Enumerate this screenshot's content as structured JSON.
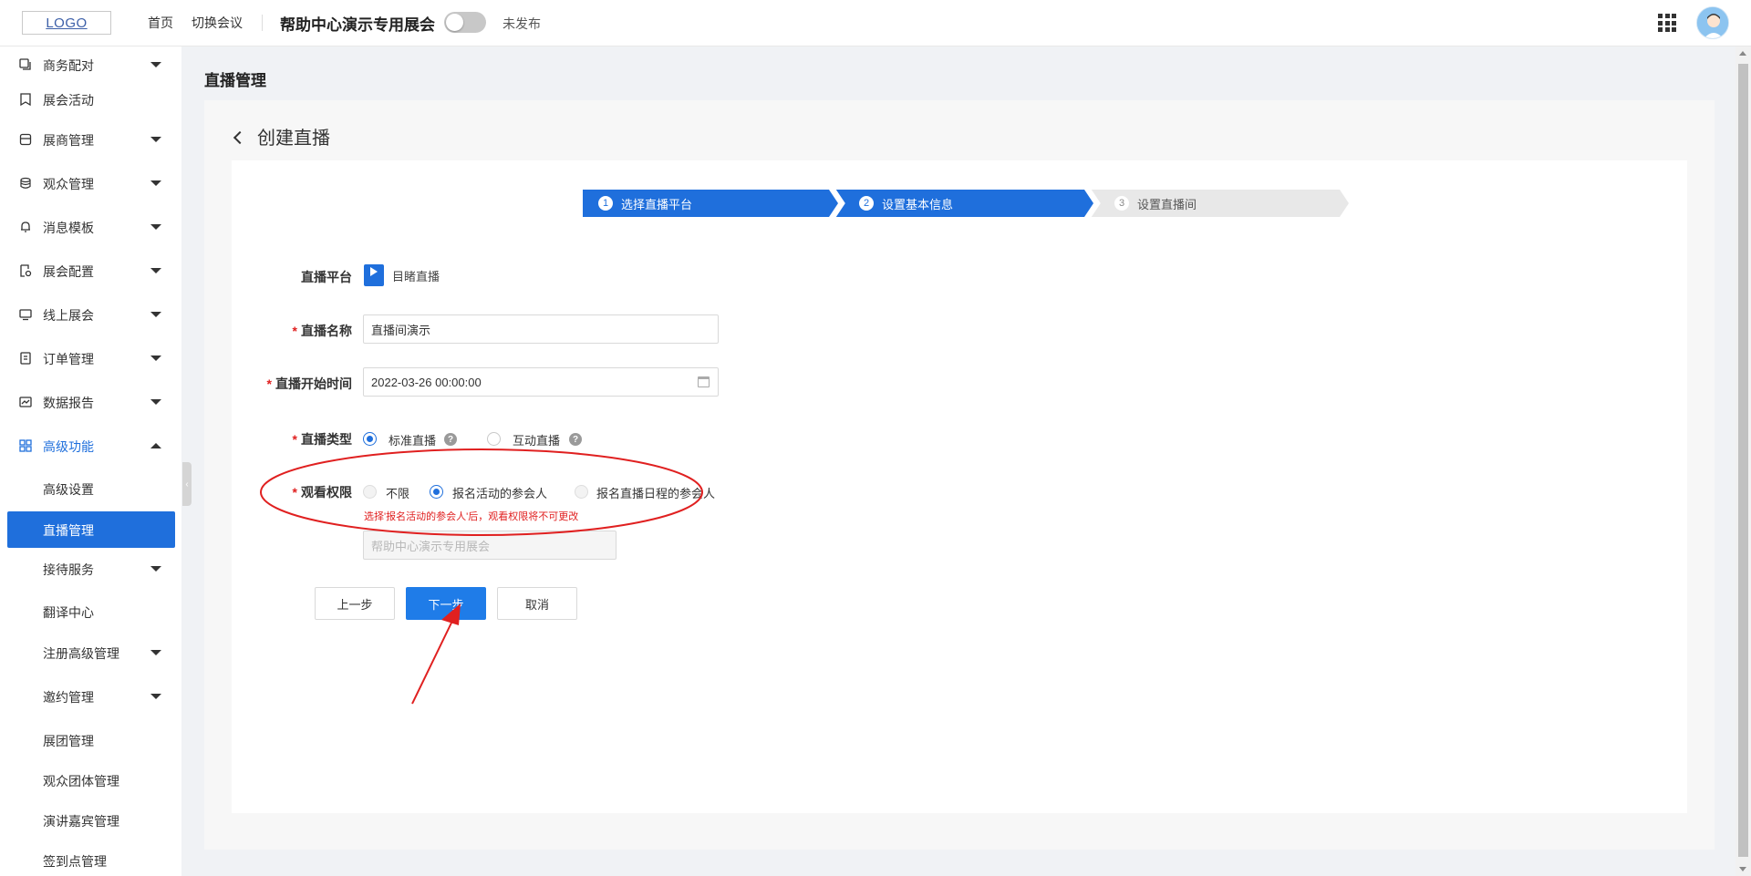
{
  "header": {
    "logo": "LOGO",
    "nav": {
      "home": "首页",
      "switch_meeting": "切换会议"
    },
    "expo_title": "帮助中心演示专用展会",
    "publish_status": "未发布"
  },
  "sidebar": {
    "items": [
      {
        "label": "商务配对",
        "icon": "copy-icon",
        "caret": "down"
      },
      {
        "label": "展会活动",
        "icon": "bookmark-icon",
        "caret": ""
      },
      {
        "label": "展商管理",
        "icon": "store-icon",
        "caret": "down"
      },
      {
        "label": "观众管理",
        "icon": "database-icon",
        "caret": "down"
      },
      {
        "label": "消息模板",
        "icon": "bell-icon",
        "caret": "down"
      },
      {
        "label": "展会配置",
        "icon": "settings-doc-icon",
        "caret": "down"
      },
      {
        "label": "线上展会",
        "icon": "monitor-icon",
        "caret": "down"
      },
      {
        "label": "订单管理",
        "icon": "order-icon",
        "caret": "down"
      },
      {
        "label": "数据报告",
        "icon": "chart-icon",
        "caret": "down"
      },
      {
        "label": "高级功能",
        "icon": "grid-icon",
        "caret": "up"
      }
    ],
    "sub_items": [
      {
        "label": "高级设置",
        "caret": ""
      },
      {
        "label": "直播管理",
        "caret": ""
      },
      {
        "label": "接待服务",
        "caret": "down"
      },
      {
        "label": "翻译中心",
        "caret": ""
      },
      {
        "label": "注册高级管理",
        "caret": "down"
      },
      {
        "label": "邀约管理",
        "caret": "down"
      },
      {
        "label": "展团管理",
        "caret": ""
      },
      {
        "label": "观众团体管理",
        "caret": ""
      },
      {
        "label": "演讲嘉宾管理",
        "caret": ""
      },
      {
        "label": "签到点管理",
        "caret": ""
      }
    ]
  },
  "main": {
    "page_heading": "直播管理",
    "back_title": "创建直播",
    "steps": [
      {
        "num": "1",
        "label": "选择直播平台",
        "state": "done"
      },
      {
        "num": "2",
        "label": "设置基本信息",
        "state": "active"
      },
      {
        "num": "3",
        "label": "设置直播间",
        "state": "pending"
      }
    ],
    "form": {
      "platform_label": "直播平台",
      "platform_name": "目睹直播",
      "required_mark": "*",
      "name_label": "直播名称",
      "name_value": "直播间演示",
      "start_label": "直播开始时间",
      "start_value": "2022-03-26 00:00:00",
      "type_label": "直播类型",
      "type_options": [
        "标准直播",
        "互动直播"
      ],
      "type_selected": "标准直播",
      "help_mark": "?",
      "permission_label": "观看权限",
      "permission_options": [
        "不限",
        "报名活动的参会人",
        "报名直播日程的参会人"
      ],
      "permission_selected": "报名活动的参会人",
      "permission_hint": "选择'报名活动的参会人'后，观看权限将不可更改",
      "event_value": "帮助中心演示专用展会"
    },
    "buttons": {
      "prev": "上一步",
      "next": "下一步",
      "cancel": "取消"
    }
  },
  "colors": {
    "primary": "#1f6fdc",
    "annotation": "#e02020",
    "step_inactive": "#e8e8e8"
  }
}
